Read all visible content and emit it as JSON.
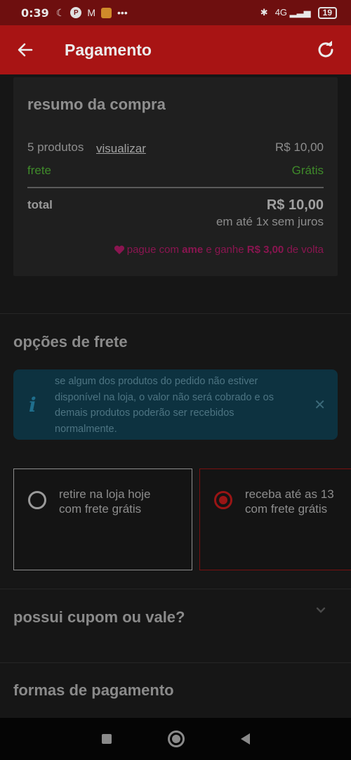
{
  "status_bar": {
    "time": "0:39",
    "network": "4G",
    "battery": "19"
  },
  "header": {
    "title": "Pagamento"
  },
  "summary": {
    "title": "resumo da compra",
    "products_label": "5 produtos",
    "view_link": "visualizar",
    "products_value": "R$ 10,00",
    "shipping_label": "frete",
    "shipping_value": "Grátis",
    "total_label": "total",
    "total_value": "R$ 10,00",
    "installments": "em até 1x sem juros",
    "ame_pre": "pague com ",
    "ame_brand": "ame",
    "ame_mid": " e ganhe ",
    "ame_amount": "R$ 3,00",
    "ame_post": " de volta"
  },
  "shipping_options": {
    "title": "opções de frete",
    "info_text": "se algum dos produtos do pedido não estiver disponível na loja, o valor não será cobrado e os demais produtos poderão ser recebidos normalmente.",
    "options": [
      {
        "line1": "retire na loja hoje",
        "line2": "com frete grátis",
        "selected": false
      },
      {
        "line1": "receba até as 13",
        "line2": "com frete grátis",
        "selected": true
      }
    ]
  },
  "coupon": {
    "title": "possui cupom ou vale?"
  },
  "payment": {
    "title": "formas de pagamento"
  },
  "colors": {
    "brand_red": "#a81414",
    "ame_pink": "#8a1550",
    "free_green": "#3f8a2a",
    "info_bg": "#0d3240"
  },
  "icons": [
    "moon-icon",
    "p-app-icon",
    "gmail-icon",
    "app-icon",
    "more-icon",
    "bluetooth-icon",
    "signal-icon",
    "battery-icon",
    "back-arrow-icon",
    "refresh-icon",
    "heart-icon",
    "info-icon",
    "close-icon",
    "chevron-down-icon"
  ]
}
